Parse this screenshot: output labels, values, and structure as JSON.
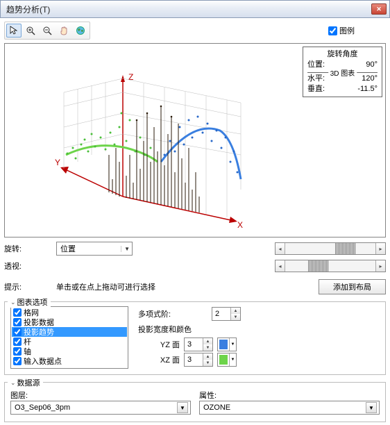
{
  "window": {
    "title": "趋势分析(T)"
  },
  "toolbar": {
    "icons": [
      "pointer",
      "zoom-in",
      "zoom-out",
      "pan",
      "globe"
    ]
  },
  "legend": {
    "label": "图例",
    "checked": true
  },
  "angle_panel": {
    "title": "旋转角度",
    "position_label": "位置:",
    "position_value": "90°",
    "chart3d_label": "3D 图表",
    "horiz_label": "水平:",
    "horiz_value": "120°",
    "vert_label": "垂直:",
    "vert_value": "-11.5°"
  },
  "rotate": {
    "label": "旋转:",
    "dropdown": "位置"
  },
  "perspective": {
    "label": "透视:"
  },
  "hint": {
    "label": "提示:",
    "text": "单击或在点上拖动可进行选择"
  },
  "add_layout": "添加到布局",
  "chart_options": {
    "legend": "图表选项",
    "items": [
      {
        "label": "格网",
        "checked": true
      },
      {
        "label": "投影数据",
        "checked": true
      },
      {
        "label": "投影趋势",
        "checked": true,
        "selected": true
      },
      {
        "label": "杆",
        "checked": true
      },
      {
        "label": "轴",
        "checked": true
      },
      {
        "label": "输入数据点",
        "checked": true
      }
    ],
    "poly_label": "多项式阶:",
    "poly_value": "2",
    "width_color_label": "投影宽度和颜色",
    "yz_label": "YZ 面",
    "yz_value": "3",
    "yz_color": "#3a7fe0",
    "xz_label": "XZ 面",
    "xz_value": "3",
    "xz_color": "#6dd44a"
  },
  "datasource": {
    "legend": "数据源",
    "layer_label": "图层:",
    "layer_value": "O3_Sep06_3pm",
    "attr_label": "属性:",
    "attr_value": "OZONE"
  },
  "chart_data": {
    "type": "3d-scatter-trend",
    "axes": [
      "X",
      "Y",
      "Z"
    ],
    "yz_trend_color": "#3a7fe0",
    "xz_trend_color": "#6dd44a",
    "note": "3D projected scatter with fitted trend curves on XZ and YZ planes; dense stem plot of input points"
  }
}
